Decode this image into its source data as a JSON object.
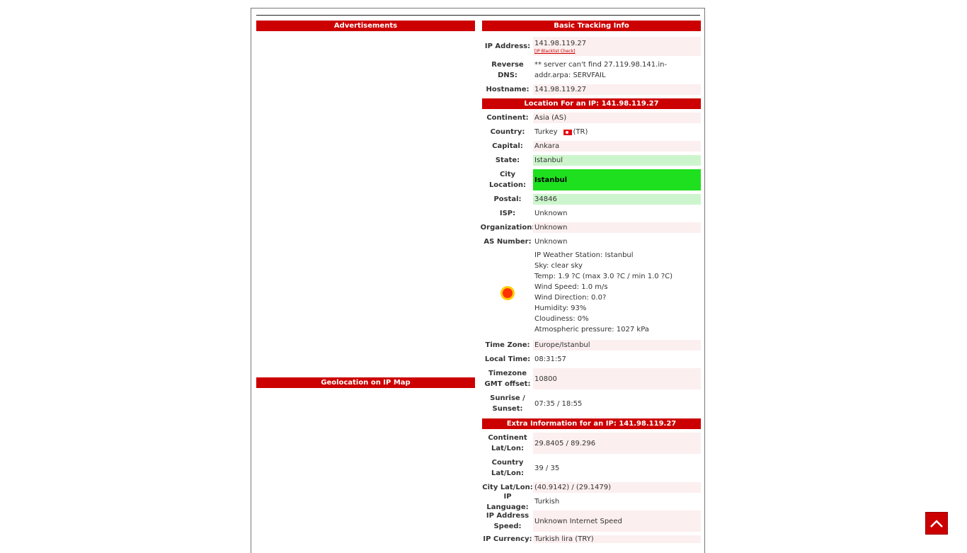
{
  "left": {
    "ads_header": "Advertisements",
    "map_header": "Geolocation on IP Map"
  },
  "basic": {
    "header": "Basic Tracking Info",
    "ip_label": "IP Address:",
    "ip_value": "141.98.119.27",
    "blacklist_link": "[IP Blacklist Check]",
    "rdns_label": "Reverse DNS:",
    "rdns_value": "** server can't find 27.119.98.141.in-addr.arpa: SERVFAIL",
    "host_label": "Hostname:",
    "host_value": "141.98.119.27"
  },
  "location": {
    "header": "Location For an IP: 141.98.119.27",
    "continent_label": "Continent:",
    "continent_value": "Asia (AS)",
    "country_label": "Country:",
    "country_name": "Turkey",
    "country_code": "(TR)",
    "capital_label": "Capital:",
    "capital_value": "Ankara",
    "state_label": "State:",
    "state_value": "Istanbul",
    "city_label": "City Location:",
    "city_value": "Istanbul",
    "postal_label": "Postal:",
    "postal_value": "34846",
    "isp_label": "ISP:",
    "isp_value": "Unknown",
    "org_label": "Organization:",
    "org_value": "Unknown",
    "as_label": "AS Number:",
    "as_value": "Unknown",
    "weather_lines": [
      "IP Weather Station: Istanbul",
      "Sky: clear sky",
      "Temp: 1.9 ?C (max 3.0 ?C / min 1.0 ?C)",
      "Wind Speed: 1.0 m/s",
      "Wind Direction: 0.0?",
      "Humidity: 93%",
      "Cloudiness: 0%",
      "Atmospheric pressure: 1027 kPa"
    ],
    "tz_label": "Time Zone:",
    "tz_value": "Europe/Istanbul",
    "local_label": "Local Time:",
    "local_value": "08:31:57",
    "gmt_label": "Timezone GMT offset:",
    "gmt_value": "10800",
    "sun_label": "Sunrise / Sunset:",
    "sun_value": "07:35 / 18:55"
  },
  "extra": {
    "header": "Extra Information for an IP: 141.98.119.27",
    "cont_ll_label": "Continent Lat/Lon:",
    "cont_ll_value": "29.8405 / 89.296",
    "country_ll_label": "Country Lat/Lon:",
    "country_ll_value": "39 / 35",
    "city_ll_label": "City Lat/Lon:",
    "city_ll_value": "(40.9142) / (29.1479)",
    "lang_label": "IP Language:",
    "lang_value": "Turkish",
    "speed_label": "IP Address Speed:",
    "speed_value": "Unknown Internet Speed",
    "currency_label": "IP Currency:",
    "currency_value": "Turkish lira (TRY)"
  },
  "colors": {
    "header_red": "#cc0000",
    "row_pink": "#fcefef",
    "state_green": "#cdf5cd",
    "city_green": "#1ee01e"
  },
  "icons": {
    "weather": "sun-icon",
    "flag": "turkey-flag-icon",
    "scroll_top": "chevron-up-icon"
  }
}
